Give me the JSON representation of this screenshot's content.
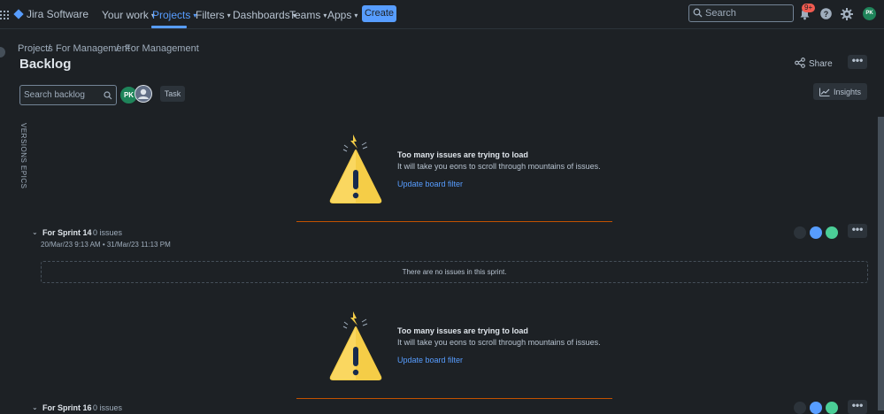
{
  "topnav": {
    "app_name": "Jira Software",
    "items": [
      {
        "label": "Your work"
      },
      {
        "label": "Projects"
      },
      {
        "label": "Filters"
      },
      {
        "label": "Dashboards"
      },
      {
        "label": "Teams"
      },
      {
        "label": "Apps"
      }
    ],
    "create_label": "Create",
    "search_placeholder": "Search",
    "notification_badge": "9+",
    "user_initials": "PK",
    "colors": {
      "accent": "#579dff",
      "avatar": "#1f845a",
      "badge": "#f15b50"
    }
  },
  "breadcrumb": [
    "Projects",
    "/",
    "For Management",
    "/",
    "For Management"
  ],
  "page_title": "Backlog",
  "share_label": "Share",
  "insights_label": "Insights",
  "backlog_search_placeholder": "Search backlog",
  "member_initials": "PK",
  "task_filter_label": "Task",
  "side_tabs": [
    "VERSIONS",
    "EPICS"
  ],
  "warnings": [
    {
      "title": "Too many issues are trying to load",
      "description": "It will take you eons to scroll through mountains of issues.",
      "link": "Update board filter"
    },
    {
      "title": "Too many issues are trying to load",
      "description": "It will take you eons to scroll through mountains of issues.",
      "link": "Update board filter"
    }
  ],
  "sprints": [
    {
      "name": "For Sprint 14",
      "count": "0 issues",
      "dates": "20/Mar/23 9:13 AM • 31/Mar/23 11:13 PM",
      "empty_message": "There are no issues in this sprint."
    },
    {
      "name": "For Sprint 16",
      "count": "0 issues"
    }
  ],
  "status_dot_colors": [
    "#2c333a",
    "#579dff",
    "#4bce97"
  ]
}
